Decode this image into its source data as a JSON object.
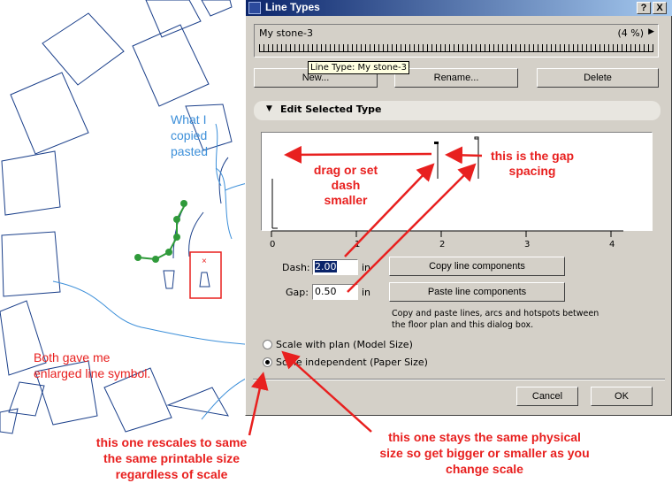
{
  "dialog": {
    "title": "Line Types",
    "help_button": "?",
    "close_button": "X",
    "line_type": {
      "name": "My stone-3",
      "percent": "(4 %)"
    },
    "tooltip": "Line Type: My stone-3",
    "buttons": {
      "new": "New...",
      "rename": "Rename...",
      "delete": "Delete",
      "copy": "Copy line components",
      "paste": "Paste line components",
      "cancel": "Cancel",
      "ok": "OK"
    },
    "section_title": "Edit Selected Type",
    "ruler_labels": [
      "0",
      "1",
      "2",
      "3",
      "4"
    ],
    "dash_label": "Dash:",
    "dash_value": "2.00",
    "gap_label": "Gap:",
    "gap_value": "0.50",
    "unit": "in",
    "help_text": "Copy and paste lines, arcs and hotspots between the floor plan and this dialog box.",
    "radio_model": "Scale with plan (Model Size)",
    "radio_paper": "Scale independent (Paper Size)",
    "selected_scale": "paper"
  },
  "annotations": {
    "drag_text": [
      "drag or set",
      "dash",
      "smaller"
    ],
    "gap_text": [
      "this is the gap",
      "spacing"
    ],
    "copied_text": [
      "What I",
      "copied",
      "pasted"
    ],
    "both_text": [
      "Both gave me",
      "enlarged line symbol."
    ],
    "rescale_text": [
      "this one rescales to same",
      "the same printable size",
      "regardless of scale"
    ],
    "physical_text": [
      "this one stays the same physical",
      "size so get bigger or smaller as you",
      "change scale"
    ],
    "colors": {
      "red": "#e8201f",
      "blue": "#3c8fd9"
    }
  }
}
